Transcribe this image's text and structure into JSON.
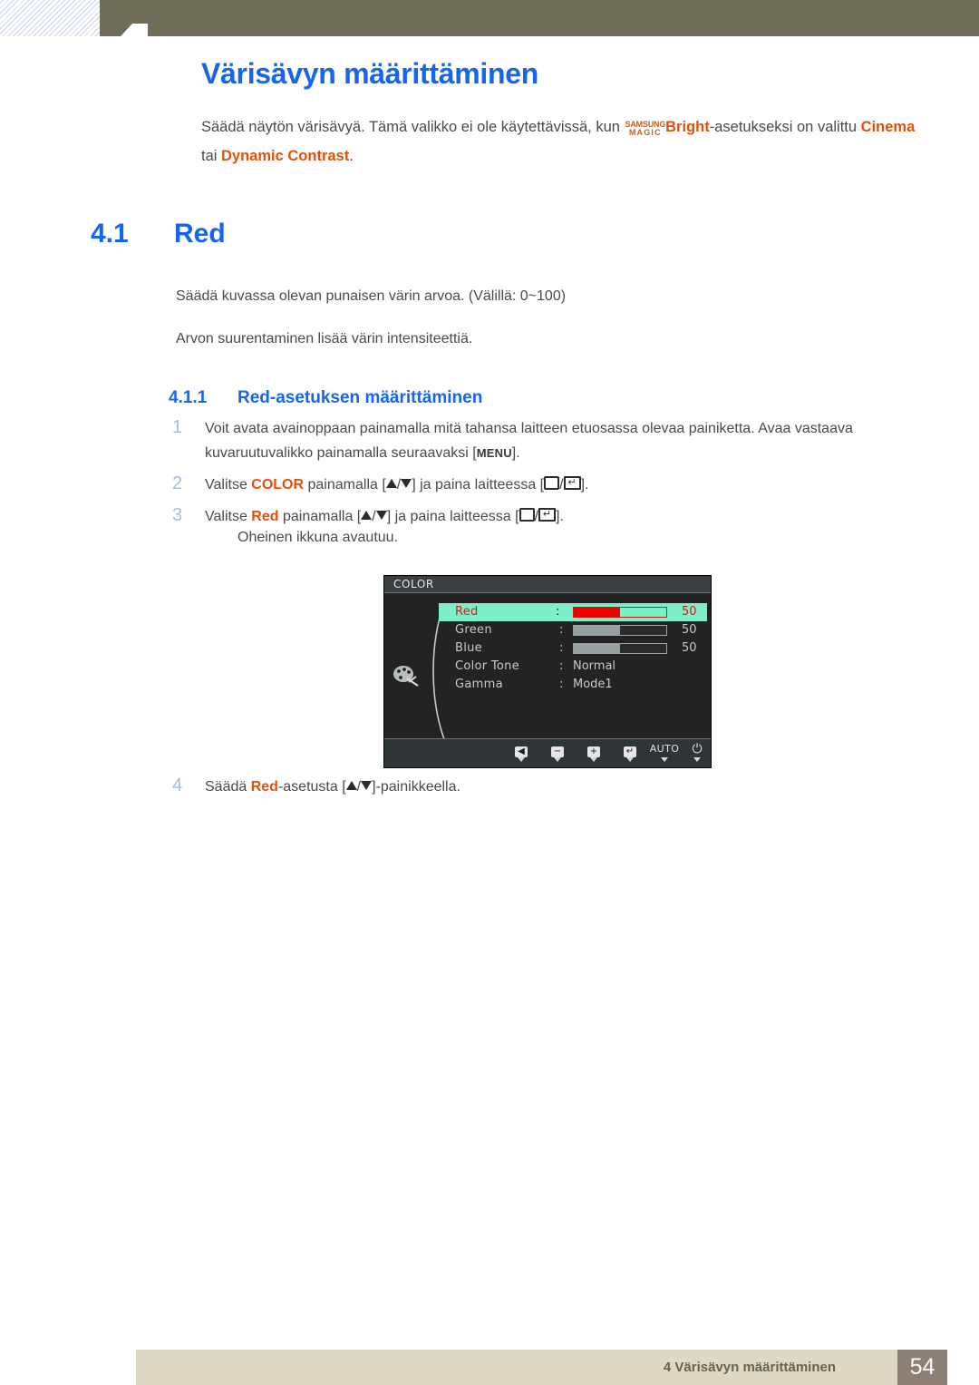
{
  "header": {
    "title": "Värisävyn määrittäminen"
  },
  "intro": {
    "part1": "Säädä näytön värisävyä. Tämä valikko ei ole käytettävissä, kun ",
    "magic_line1": "SAMSUNG",
    "magic_line2": "MAGIC",
    "bright": "Bright",
    "part2": "-asetukseksi on valittu ",
    "kw_cinema": "Cinema",
    "part3": " tai ",
    "kw_dynamic": "Dynamic Contrast",
    "part4": "."
  },
  "section": {
    "number": "4.1",
    "title": "Red",
    "para_range": "Säädä kuvassa olevan punaisen värin arvoa. (Välillä: 0~100)",
    "para_intensity": "Arvon suurentaminen lisää värin intensiteettiä."
  },
  "subsection": {
    "number": "4.1.1",
    "title": "Red-asetuksen määrittäminen"
  },
  "steps": [
    {
      "num": "1",
      "text_a": "Voit avata avainoppaan painamalla mitä tahansa laitteen etuosassa olevaa painiketta. Avaa vastaava kuvaruutuvalikko painamalla seuraavaksi [",
      "menu_key": "MENU",
      "text_b": "]."
    },
    {
      "num": "2",
      "text_a": "Valitse ",
      "kw": "COLOR",
      "text_b": " painamalla [",
      "text_c": "] ja paina laitteessa [",
      "text_d": "]."
    },
    {
      "num": "3",
      "text_a": "Valitse ",
      "kw": "Red",
      "text_b": " painamalla [",
      "text_c": "] ja paina laitteessa [",
      "text_d": "].",
      "note": "Oheinen ikkuna avautuu."
    },
    {
      "num": "4",
      "text_a": "Säädä ",
      "kw": "Red",
      "text_b": "-asetusta [",
      "text_c": "]-painikkeella."
    }
  ],
  "osd": {
    "title": "COLOR",
    "rows": [
      {
        "label": "Red",
        "value": "50",
        "type": "slider",
        "fill_pct": 50,
        "highlighted": true
      },
      {
        "label": "Green",
        "value": "50",
        "type": "slider",
        "fill_pct": 50,
        "highlighted": false
      },
      {
        "label": "Blue",
        "value": "50",
        "type": "slider",
        "fill_pct": 50,
        "highlighted": false
      },
      {
        "label": "Color Tone",
        "value": "Normal",
        "type": "text",
        "highlighted": false
      },
      {
        "label": "Gamma",
        "value": "Mode1",
        "type": "text",
        "highlighted": false
      }
    ],
    "buttons": [
      {
        "name": "back",
        "glyph": "◀"
      },
      {
        "name": "minus",
        "glyph": "−"
      },
      {
        "name": "plus",
        "glyph": "+"
      },
      {
        "name": "enter",
        "glyph": "↵"
      },
      {
        "name": "auto",
        "glyph": "AUTO"
      },
      {
        "name": "power",
        "glyph": "⏻"
      }
    ],
    "colors": {
      "highlight": "#7fefc8",
      "highlight_text": "#d11a1a",
      "slider_fill_red": "#ee0000",
      "slider_fill_gray": "#96a0a0",
      "panel_bg": "#232323"
    }
  },
  "footer": {
    "text": "4 Värisävyn määrittäminen",
    "page": "54"
  },
  "theme": {
    "heading_blue": "#1565f0",
    "keyword_orange": "#e2500c",
    "header_olive": "#6f6c57",
    "footer_beige": "#ded8c4",
    "footer_page_brown": "#8e7f74"
  }
}
